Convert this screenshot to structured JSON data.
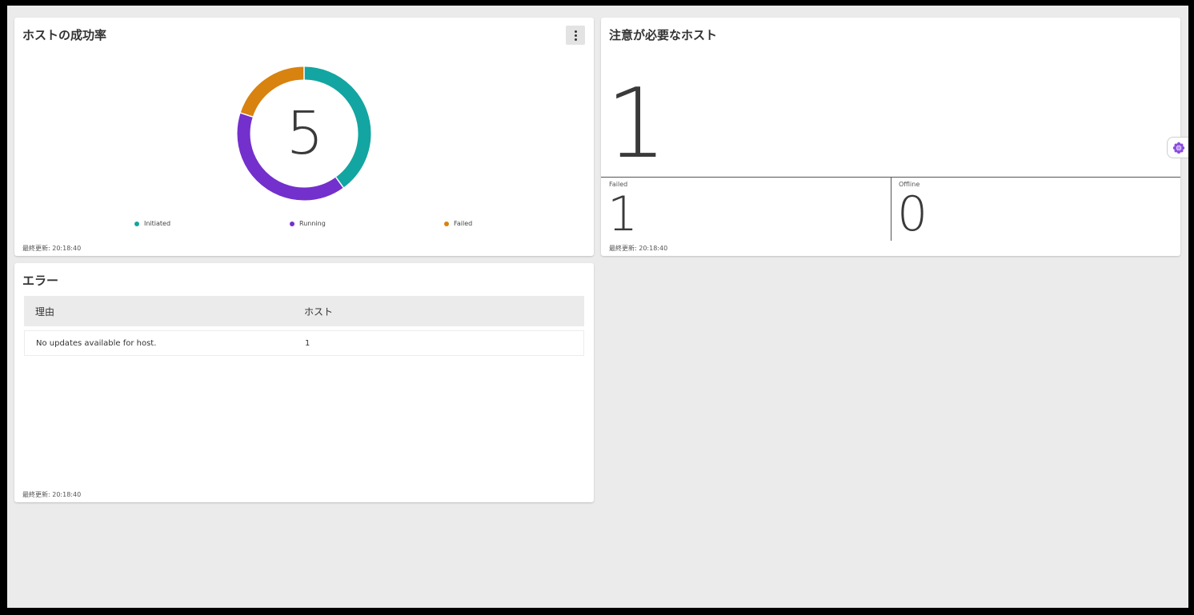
{
  "success_card": {
    "title": "ホストの成功率",
    "total": "5",
    "legend": [
      {
        "label": "Initiated",
        "color": "#13a5a1"
      },
      {
        "label": "Running",
        "color": "#7330cc"
      },
      {
        "label": "Failed",
        "color": "#d8820f"
      }
    ],
    "last_updated": "最終更新: 20:18:40"
  },
  "chart_data": {
    "type": "pie",
    "center_label": "5",
    "categories": [
      "Initiated",
      "Running",
      "Failed"
    ],
    "values": [
      2,
      2,
      1
    ],
    "colors": [
      "#13a5a1",
      "#7330cc",
      "#d8820f"
    ],
    "legend_position": "bottom"
  },
  "attention_card": {
    "title": "注意が必要なホスト",
    "total": "1",
    "failed_label": "Failed",
    "failed_value": "1",
    "offline_label": "Offline",
    "offline_value": "0",
    "last_updated": "最終更新: 20:18:40"
  },
  "errors_card": {
    "title": "エラー",
    "columns": {
      "reason": "理由",
      "host": "ホスト"
    },
    "rows": [
      {
        "reason": "No updates available for host.",
        "host": "1"
      }
    ],
    "last_updated": "最終更新: 20:18:40"
  },
  "side_tab": {
    "icon": "flower-icon",
    "color": "#8a4ddf"
  }
}
